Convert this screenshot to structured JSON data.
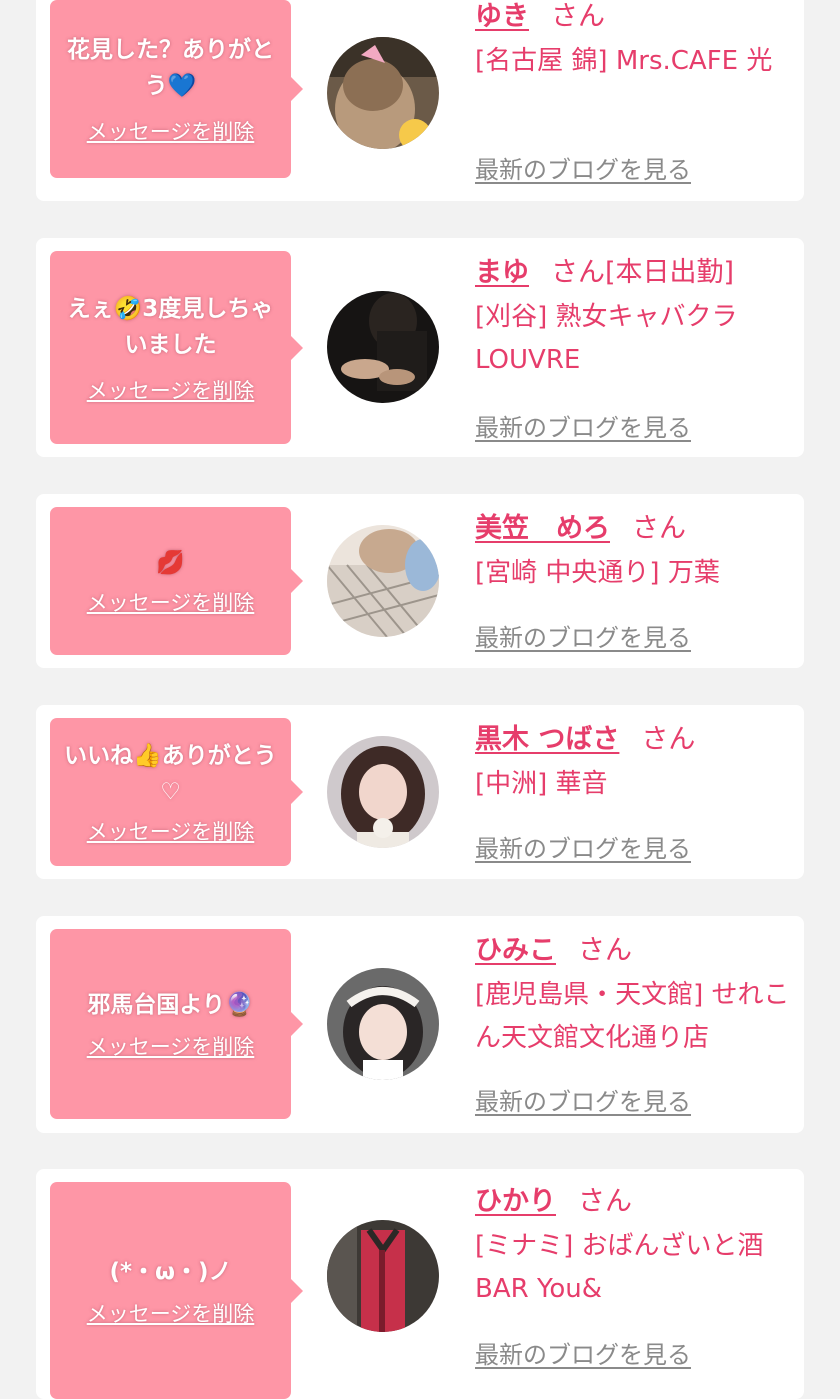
{
  "cards": [
    {
      "message": "花見した？ありがとう💙",
      "delete_label": "メッセージを削除",
      "name": "ゆき",
      "san": "さん",
      "status": "",
      "shop": "[名古屋 錦] Mrs.CAFE 光",
      "blog_label": "最新のブログを見る"
    },
    {
      "message": "えぇ🤣3度見しちゃいました",
      "delete_label": "メッセージを削除",
      "name": "まゆ",
      "san": "さん",
      "status": "[本日出勤]",
      "shop": "[刈谷] 熟女キャバクラ LOUVRE",
      "blog_label": "最新のブログを見る"
    },
    {
      "message": "💋",
      "delete_label": "メッセージを削除",
      "name": "美笠　めろ",
      "san": "さん",
      "status": "",
      "shop": "[宮崎 中央通り] 万葉",
      "blog_label": "最新のブログを見る"
    },
    {
      "message": "いいね👍ありがとう♡",
      "delete_label": "メッセージを削除",
      "name": "黒木 つばさ",
      "san": "さん",
      "status": "",
      "shop": "[中洲] 華音",
      "blog_label": "最新のブログを見る"
    },
    {
      "message": "邪馬台国より🔮",
      "delete_label": "メッセージを削除",
      "name": "ひみこ",
      "san": "さん",
      "status": "",
      "shop": "[鹿児島県・天文館] せれこん天文館文化通り店",
      "blog_label": "最新のブログを見る"
    },
    {
      "message": "(*・ω・)ノ",
      "delete_label": "メッセージを削除",
      "name": "ひかり",
      "san": "さん",
      "status": "",
      "shop": "[ミナミ] おばんざいと酒BAR You&",
      "blog_label": "最新のブログを見る"
    }
  ],
  "colors": {
    "page_bg": "#f2f2f2",
    "card_bg": "#ffffff",
    "bubble_bg": "#fe96a6",
    "accent_text": "#e63d6b",
    "blog_link": "#8a8a8a"
  }
}
